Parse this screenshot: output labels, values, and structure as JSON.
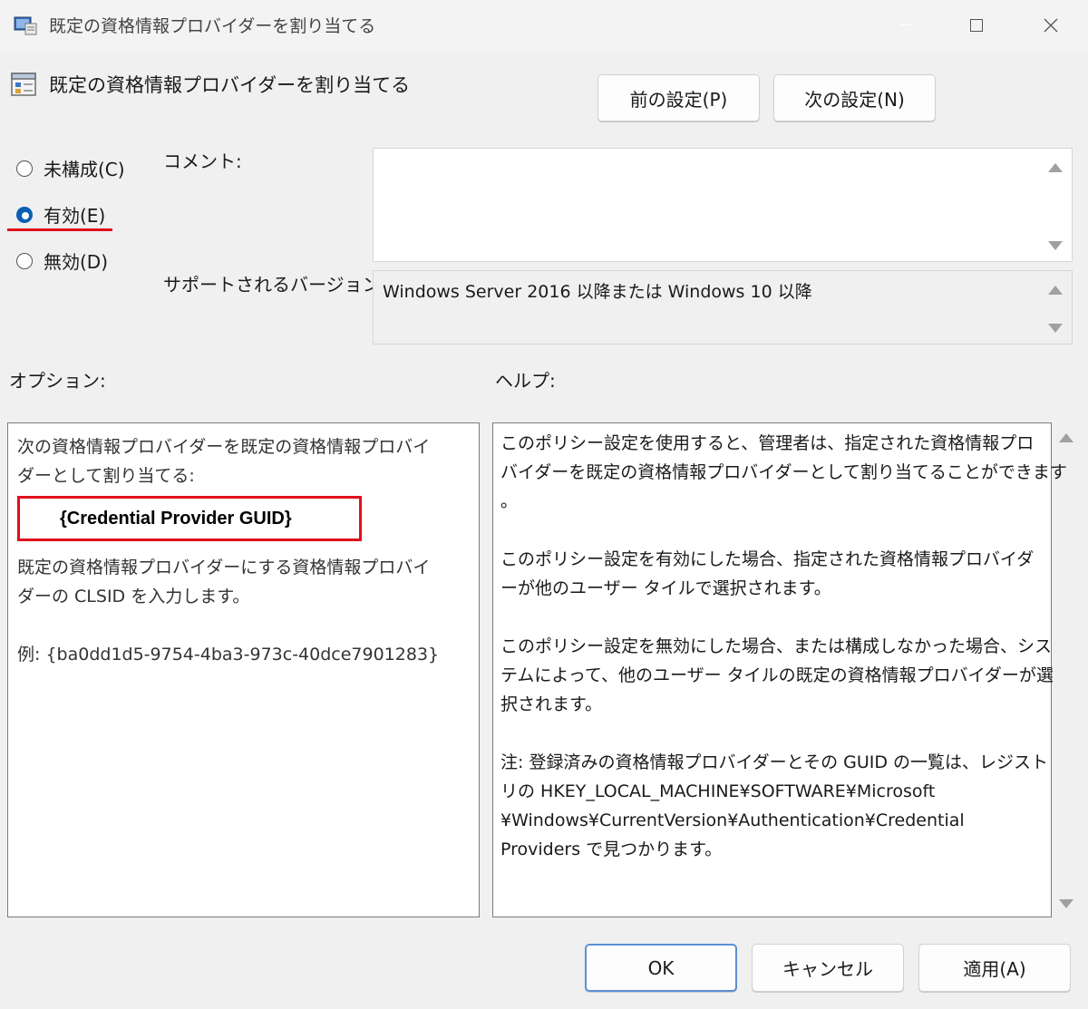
{
  "window": {
    "title": "既定の資格情報プロバイダーを割り当てる"
  },
  "header": {
    "title": "既定の資格情報プロバイダーを割り当てる",
    "prev_button": "前の設定(P)",
    "next_button": "次の設定(N)"
  },
  "state": {
    "options": [
      {
        "label": "未構成(C)",
        "checked": false
      },
      {
        "label": "有効(E)",
        "checked": true
      },
      {
        "label": "無効(D)",
        "checked": false
      }
    ]
  },
  "comment": {
    "label": "コメント:",
    "value": ""
  },
  "supported": {
    "label": "サポートされるバージョン:",
    "value": "Windows Server 2016 以降または Windows 10 以降"
  },
  "options_panel": {
    "heading": "オプション:",
    "line1": "次の資格情報プロバイダーを既定の資格情報プロバイ",
    "line2": "ダーとして割り当てる:",
    "guid_value": "{Credential Provider GUID}",
    "desc1": "既定の資格情報プロバイダーにする資格情報プロバイ",
    "desc2": "ダーの CLSID を入力します。",
    "example": "例: {ba0dd1d5-9754-4ba3-973c-40dce7901283}"
  },
  "help_panel": {
    "heading": "ヘルプ:",
    "lines": [
      "このポリシー設定を使用すると、管理者は、指定された資格情報プロ",
      "バイダーを既定の資格情報プロバイダーとして割り当てることができます",
      "。",
      "",
      "このポリシー設定を有効にした場合、指定された資格情報プロバイダ",
      "ーが他のユーザー タイルで選択されます。",
      "",
      "このポリシー設定を無効にした場合、または構成しなかった場合、シス",
      "テムによって、他のユーザー タイルの既定の資格情報プロバイダーが選",
      "択されます。",
      "",
      "注: 登録済みの資格情報プロバイダーとその GUID の一覧は、レジスト",
      "リの HKEY_LOCAL_MACHINE¥SOFTWARE¥Microsoft",
      "¥Windows¥CurrentVersion¥Authentication¥Credential",
      "Providers で見つかります。"
    ]
  },
  "footer": {
    "ok": "OK",
    "cancel": "キャンセル",
    "apply": "適用(A)"
  },
  "colors": {
    "accent": "#0a5fb4",
    "highlight_red": "#e0101c"
  }
}
